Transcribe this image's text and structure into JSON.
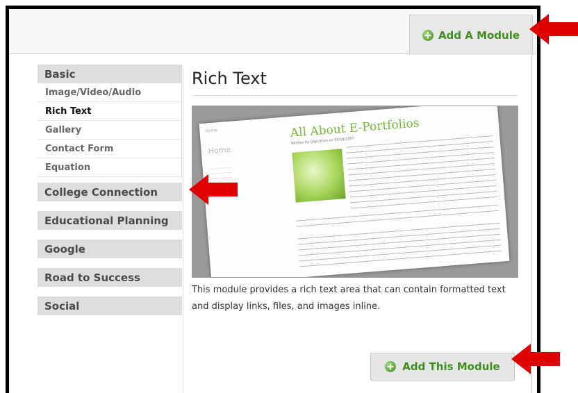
{
  "header": {
    "add_module_tab": {
      "label": "Add A Module",
      "icon": "plus-circle-icon"
    }
  },
  "sidebar": {
    "categories": [
      {
        "label": "Basic",
        "items": [
          "Image/Video/Audio",
          "Rich Text",
          "Gallery",
          "Contact Form",
          "Equation"
        ],
        "active": "Rich Text"
      },
      {
        "label": "College Connection"
      },
      {
        "label": "Educational Planning"
      },
      {
        "label": "Google"
      },
      {
        "label": "Road to Success"
      },
      {
        "label": "Social"
      }
    ]
  },
  "main": {
    "title": "Rich Text",
    "preview": {
      "crumb": "Home",
      "home_label": "Home",
      "doc_title": "All About E-Portfolios",
      "byline": "Written by Digication on 10/18/2007"
    },
    "description": "This module provides a rich text area that can contain formatted text and display links, files, and images inline.",
    "add_button": {
      "label": "Add This Module",
      "icon": "plus-circle-icon"
    }
  },
  "colors": {
    "accent_green": "#3f8e1f",
    "callout_red": "#e00000",
    "sidebar_category_bg": "#dedede"
  }
}
